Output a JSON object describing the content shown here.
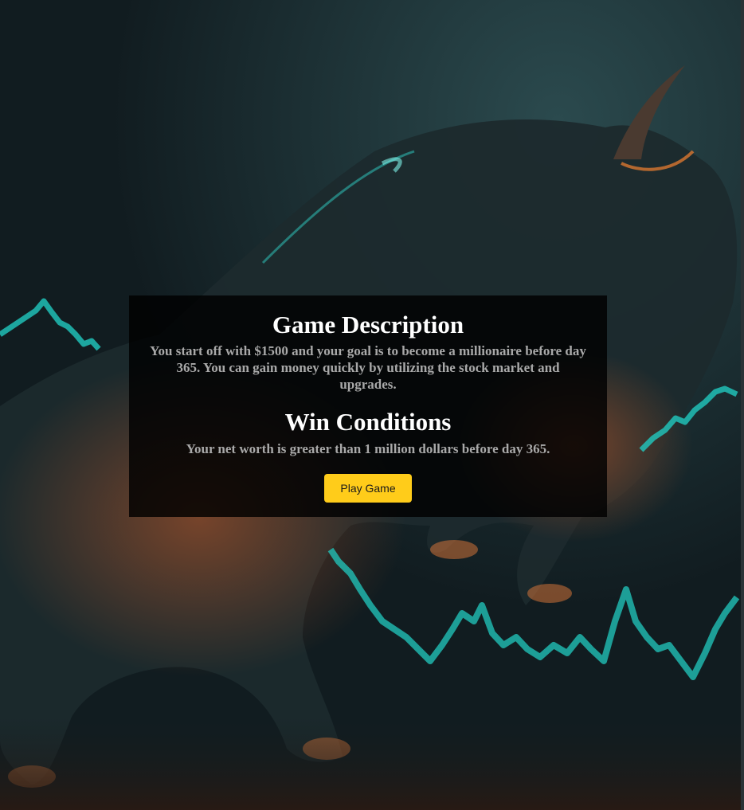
{
  "description": {
    "title": "Game Description",
    "text": "You start off with $1500 and your goal is to become a millionaire before day 365. You can gain money quickly by utilizing the stock market and upgrades."
  },
  "win": {
    "title": "Win Conditions",
    "text": "Your net worth is greater than 1 million dollars before day 365."
  },
  "play_button": {
    "label": "Play Game"
  },
  "colors": {
    "panel_bg": "#000000",
    "button_bg": "#ffcc1a",
    "heading": "#ffffff",
    "body_text": "#a9a9a9",
    "chart_glow": "#1fc9c0",
    "bull_glow": "#e0703a"
  }
}
